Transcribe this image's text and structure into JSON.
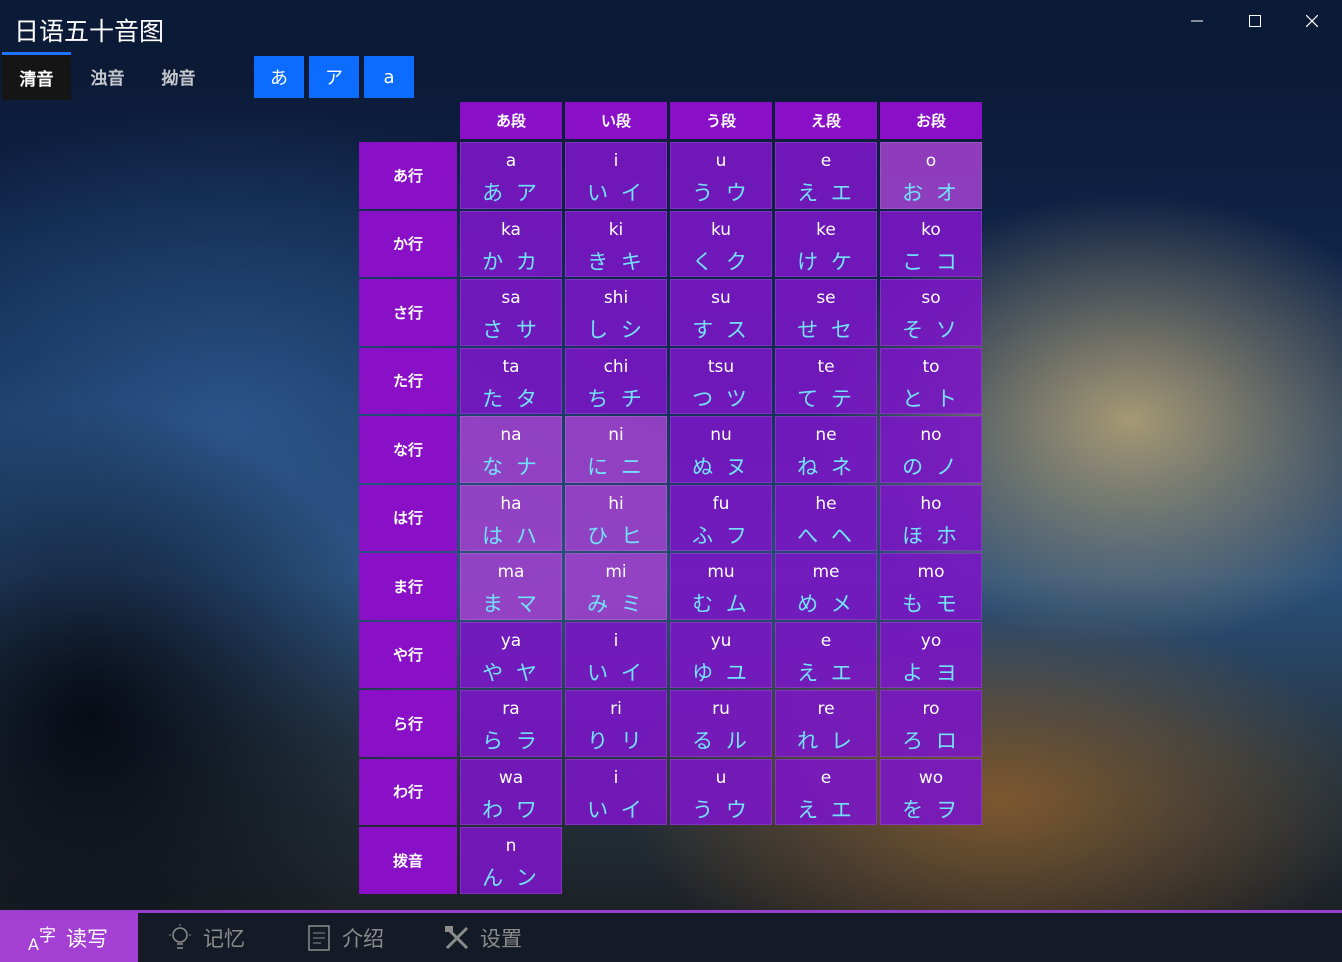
{
  "app": {
    "title": "日语五十音图"
  },
  "window_controls": {
    "minimize": "minimize-icon",
    "maximize": "maximize-icon",
    "close": "close-icon"
  },
  "tabs": [
    {
      "label": "清音",
      "selected": true
    },
    {
      "label": "浊音",
      "selected": false
    },
    {
      "label": "拗音",
      "selected": false
    }
  ],
  "mode_buttons": [
    {
      "label": "あ"
    },
    {
      "label": "ア"
    },
    {
      "label": "a"
    }
  ],
  "column_headers": [
    "あ段",
    "い段",
    "う段",
    "え段",
    "お段"
  ],
  "rows": [
    {
      "label": "あ行",
      "cells": [
        {
          "romaji": "a",
          "kana": "あ ア"
        },
        {
          "romaji": "i",
          "kana": "い イ"
        },
        {
          "romaji": "u",
          "kana": "う ウ"
        },
        {
          "romaji": "e",
          "kana": "え エ"
        },
        {
          "romaji": "o",
          "kana": "お オ"
        }
      ]
    },
    {
      "label": "か行",
      "cells": [
        {
          "romaji": "ka",
          "kana": "か カ"
        },
        {
          "romaji": "ki",
          "kana": "き キ"
        },
        {
          "romaji": "ku",
          "kana": "く ク"
        },
        {
          "romaji": "ke",
          "kana": "け ケ"
        },
        {
          "romaji": "ko",
          "kana": "こ コ"
        }
      ]
    },
    {
      "label": "さ行",
      "cells": [
        {
          "romaji": "sa",
          "kana": "さ サ"
        },
        {
          "romaji": "shi",
          "kana": "し シ"
        },
        {
          "romaji": "su",
          "kana": "す ス"
        },
        {
          "romaji": "se",
          "kana": "せ セ"
        },
        {
          "romaji": "so",
          "kana": "そ ソ"
        }
      ]
    },
    {
      "label": "た行",
      "cells": [
        {
          "romaji": "ta",
          "kana": "た タ"
        },
        {
          "romaji": "chi",
          "kana": "ち チ"
        },
        {
          "romaji": "tsu",
          "kana": "つ ツ"
        },
        {
          "romaji": "te",
          "kana": "て テ"
        },
        {
          "romaji": "to",
          "kana": "と ト"
        }
      ]
    },
    {
      "label": "な行",
      "cells": [
        {
          "romaji": "na",
          "kana": "な ナ"
        },
        {
          "romaji": "ni",
          "kana": "に ニ"
        },
        {
          "romaji": "nu",
          "kana": "ぬ ヌ"
        },
        {
          "romaji": "ne",
          "kana": "ね ネ"
        },
        {
          "romaji": "no",
          "kana": "の ノ"
        }
      ]
    },
    {
      "label": "は行",
      "cells": [
        {
          "romaji": "ha",
          "kana": "は ハ"
        },
        {
          "romaji": "hi",
          "kana": "ひ ヒ"
        },
        {
          "romaji": "fu",
          "kana": "ふ フ"
        },
        {
          "romaji": "he",
          "kana": "へ ヘ"
        },
        {
          "romaji": "ho",
          "kana": "ほ ホ"
        }
      ]
    },
    {
      "label": "ま行",
      "cells": [
        {
          "romaji": "ma",
          "kana": "ま マ"
        },
        {
          "romaji": "mi",
          "kana": "み ミ"
        },
        {
          "romaji": "mu",
          "kana": "む ム"
        },
        {
          "romaji": "me",
          "kana": "め メ"
        },
        {
          "romaji": "mo",
          "kana": "も モ"
        }
      ]
    },
    {
      "label": "や行",
      "cells": [
        {
          "romaji": "ya",
          "kana": "や ヤ"
        },
        {
          "romaji": "i",
          "kana": "い イ"
        },
        {
          "romaji": "yu",
          "kana": "ゆ ユ"
        },
        {
          "romaji": "e",
          "kana": "え エ"
        },
        {
          "romaji": "yo",
          "kana": "よ ヨ"
        }
      ]
    },
    {
      "label": "ら行",
      "cells": [
        {
          "romaji": "ra",
          "kana": "ら ラ"
        },
        {
          "romaji": "ri",
          "kana": "り リ"
        },
        {
          "romaji": "ru",
          "kana": "る ル"
        },
        {
          "romaji": "re",
          "kana": "れ レ"
        },
        {
          "romaji": "ro",
          "kana": "ろ ロ"
        }
      ]
    },
    {
      "label": "わ行",
      "cells": [
        {
          "romaji": "wa",
          "kana": "わ ワ"
        },
        {
          "romaji": "i",
          "kana": "い イ"
        },
        {
          "romaji": "u",
          "kana": "う ウ"
        },
        {
          "romaji": "e",
          "kana": "え エ"
        },
        {
          "romaji": "wo",
          "kana": "を ヲ"
        }
      ]
    },
    {
      "label": "拨音",
      "cells": [
        {
          "romaji": "n",
          "kana": "ん ン"
        }
      ]
    }
  ],
  "bottom_nav": [
    {
      "label": "读写",
      "icon": "character-a-zi-icon",
      "active": true
    },
    {
      "label": "记忆",
      "icon": "lightbulb-icon",
      "active": false
    },
    {
      "label": "介绍",
      "icon": "document-icon",
      "active": false
    },
    {
      "label": "设置",
      "icon": "tools-icon",
      "active": false
    }
  ],
  "colors": {
    "accent": "#0b6cff",
    "cell": "#7a16c4",
    "header": "#8a10c8",
    "kana_text": "#72e2ff",
    "nav_active": "#a43fd4"
  }
}
